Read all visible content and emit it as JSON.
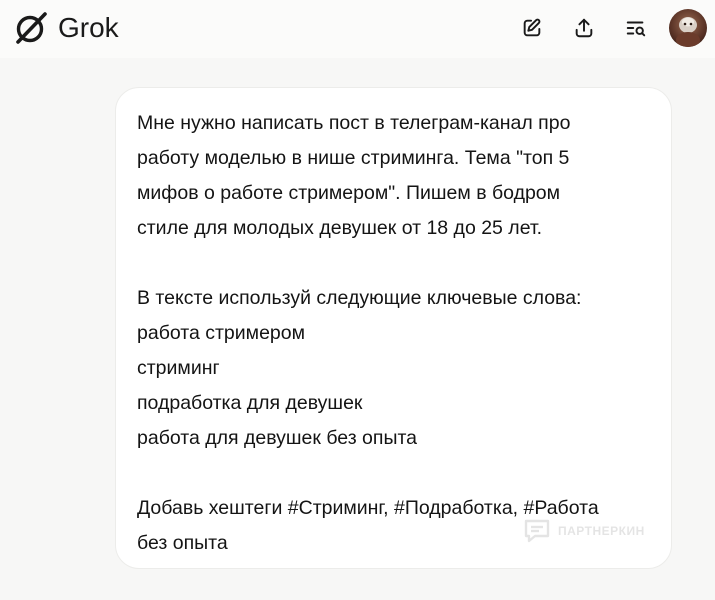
{
  "header": {
    "brand_name": "Grok",
    "icons": {
      "logo": "grok-logo-icon",
      "edit": "new-chat-edit-icon",
      "share": "share-upload-icon",
      "history": "chat-history-search-icon",
      "avatar": "user-avatar"
    }
  },
  "message": {
    "text": "Мне нужно написать пост в телеграм-канал про\nработу моделью в нише стриминга. Тема \"топ 5\nмифов о работе стримером\". Пишем в бодром\nстиле для молодых девушек от 18 до 25 лет.\n\nВ тексте используй следующие ключевые слова:\nработа стримером\nстриминг\nподработка для девушек\nработа для девушек без опыта\n\nДобавь хештеги #Стриминг, #Подработка, #Работа\nбез опыта"
  },
  "watermark": {
    "text": "ПАРТНЕРКИН"
  },
  "colors": {
    "background": "#f7f7f6",
    "bubble": "#ffffff",
    "text": "#141414"
  }
}
